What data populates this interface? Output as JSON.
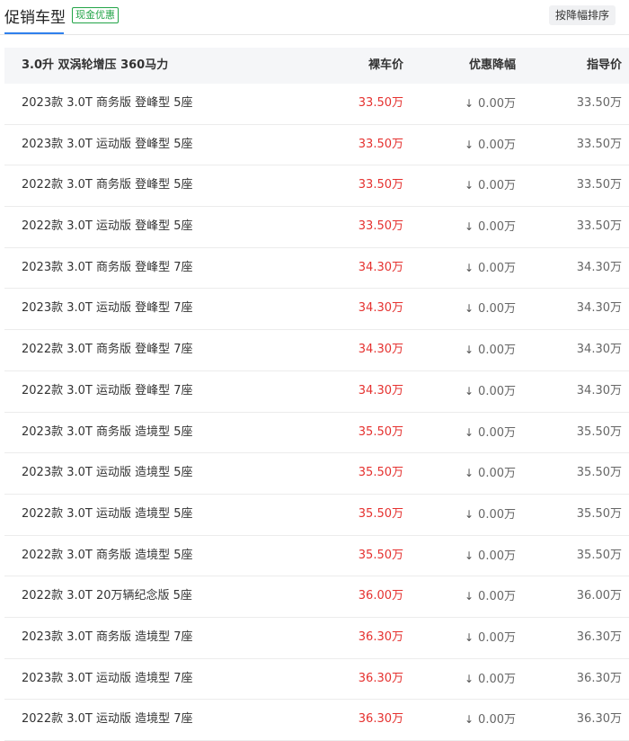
{
  "header": {
    "tab_title": "促销车型",
    "badge": "现金优惠",
    "sort_button": "按降幅排序"
  },
  "table": {
    "group_title": "3.0升 双涡轮增压 360马力",
    "columns": {
      "price": "裸车价",
      "drop": "优惠降幅",
      "guide": "指导价"
    },
    "rows": [
      {
        "name": "2023款 3.0T 商务版 登峰型 5座",
        "price": "33.50万",
        "drop": "0.00万",
        "guide": "33.50万"
      },
      {
        "name": "2023款 3.0T 运动版 登峰型 5座",
        "price": "33.50万",
        "drop": "0.00万",
        "guide": "33.50万"
      },
      {
        "name": "2022款 3.0T 商务版 登峰型 5座",
        "price": "33.50万",
        "drop": "0.00万",
        "guide": "33.50万"
      },
      {
        "name": "2022款 3.0T 运动版 登峰型 5座",
        "price": "33.50万",
        "drop": "0.00万",
        "guide": "33.50万"
      },
      {
        "name": "2023款 3.0T 商务版 登峰型 7座",
        "price": "34.30万",
        "drop": "0.00万",
        "guide": "34.30万"
      },
      {
        "name": "2023款 3.0T 运动版 登峰型 7座",
        "price": "34.30万",
        "drop": "0.00万",
        "guide": "34.30万"
      },
      {
        "name": "2022款 3.0T 商务版 登峰型 7座",
        "price": "34.30万",
        "drop": "0.00万",
        "guide": "34.30万"
      },
      {
        "name": "2022款 3.0T 运动版 登峰型 7座",
        "price": "34.30万",
        "drop": "0.00万",
        "guide": "34.30万"
      },
      {
        "name": "2023款 3.0T 商务版 造境型 5座",
        "price": "35.50万",
        "drop": "0.00万",
        "guide": "35.50万"
      },
      {
        "name": "2023款 3.0T 运动版 造境型 5座",
        "price": "35.50万",
        "drop": "0.00万",
        "guide": "35.50万"
      },
      {
        "name": "2022款 3.0T 运动版 造境型 5座",
        "price": "35.50万",
        "drop": "0.00万",
        "guide": "35.50万"
      },
      {
        "name": "2022款 3.0T 商务版 造境型 5座",
        "price": "35.50万",
        "drop": "0.00万",
        "guide": "35.50万"
      },
      {
        "name": "2022款 3.0T 20万辆纪念版 5座",
        "price": "36.00万",
        "drop": "0.00万",
        "guide": "36.00万"
      },
      {
        "name": "2023款 3.0T 商务版 造境型 7座",
        "price": "36.30万",
        "drop": "0.00万",
        "guide": "36.30万"
      },
      {
        "name": "2023款 3.0T 运动版 造境型 7座",
        "price": "36.30万",
        "drop": "0.00万",
        "guide": "36.30万"
      },
      {
        "name": "2022款 3.0T 运动版 造境型 7座",
        "price": "36.30万",
        "drop": "0.00万",
        "guide": "36.30万"
      }
    ]
  },
  "colors": {
    "price_red": "#e5312f",
    "badge_green": "#22a447",
    "tab_underline_blue": "#2f80ed",
    "header_row_bg": "#f5f6f8"
  },
  "icons": {
    "drop_arrow": "down-arrow-icon"
  }
}
